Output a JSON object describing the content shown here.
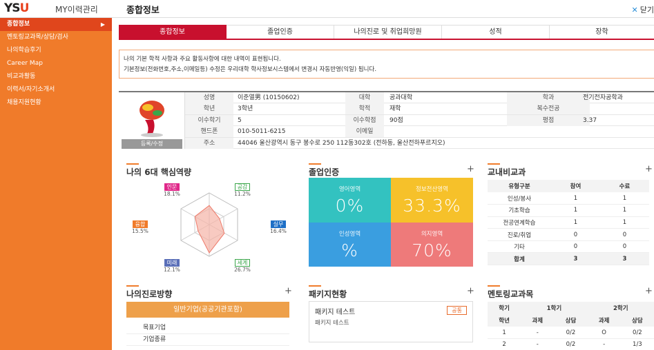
{
  "app": {
    "logo": "YSU",
    "name": "MY이력관리",
    "page_title": "종합정보",
    "close_label": "닫기"
  },
  "sidebar": {
    "items": [
      {
        "label": "종합정보",
        "active": true
      },
      {
        "label": "멘토링교과목/상담/검사"
      },
      {
        "label": "나의학습후기"
      },
      {
        "label": "Career Map"
      },
      {
        "label": "비교과활동"
      },
      {
        "label": "이력서/자기소개서"
      },
      {
        "label": "채용지원현황"
      }
    ]
  },
  "tabs": [
    "종합정보",
    "졸업인증",
    "나의진로 및 취업희망원",
    "성적",
    "장학"
  ],
  "notice": {
    "line1": "나의 기본 학적 사항과 주요 활동사항에 대한 내역이 표현됩니다.",
    "line2": "기본정보(전화번호,주소,이메일등) 수정은 우리대학 학사정보시스템에서 변경시 자동반영(익일) 됩니다."
  },
  "profile": {
    "edit_label": "등록/수정",
    "name_label": "성명",
    "name": "이준열男 (10150602)",
    "college_label": "대학",
    "college": "공과대학",
    "dept_label": "학과",
    "dept": "전기전자공학과",
    "year_label": "학년",
    "year": "3학년",
    "status_label": "학적",
    "status": "재학",
    "double_major_label": "복수전공",
    "double_major": "",
    "semester_label": "이수학기",
    "semester": "5",
    "credits_label": "이수학점",
    "credits": "90점",
    "gpa_label": "평점",
    "gpa": "3.37",
    "phone_label": "핸드폰",
    "phone": "010-5011-6215",
    "email_label": "이메일",
    "email": "",
    "address_label": "주소",
    "address": "44046 울산광역시 동구 봉수로 250 112동302호 (전하동, 울산전하푸르지오)"
  },
  "competency": {
    "title": "나의 6대 핵심역량",
    "items": [
      {
        "label": "인문",
        "value": "18.1%",
        "color": "#e0288a"
      },
      {
        "label": "공감",
        "value": "11.2%",
        "color": "#3aa64a"
      },
      {
        "label": "실무",
        "value": "16.4%",
        "color": "#1e6fc6"
      },
      {
        "label": "세계",
        "value": "26.7%",
        "color": "#3aa64a"
      },
      {
        "label": "미래",
        "value": "12.1%",
        "color": "#5a6fb8"
      },
      {
        "label": "융합",
        "value": "15.5%",
        "color": "#f07b2a"
      }
    ],
    "values": [
      18.1,
      11.2,
      16.4,
      26.7,
      12.1,
      15.5
    ]
  },
  "graduation": {
    "title": "졸업인증",
    "cells": [
      {
        "label": "영어영역",
        "value": "0%",
        "color": "#33c2c0"
      },
      {
        "label": "정보전산영역",
        "value": "33.3%",
        "color": "#f6c12a"
      },
      {
        "label": "인성영역",
        "value": "%",
        "color": "#3a9ee0"
      },
      {
        "label": "의지영역",
        "value": "70%",
        "color": "#ee7a7a"
      }
    ]
  },
  "extracurricular": {
    "title": "교내비교과",
    "headers": [
      "유형구분",
      "참여",
      "수료"
    ],
    "rows": [
      [
        "인성/봉사",
        "1",
        "1"
      ],
      [
        "기초학습",
        "1",
        "1"
      ],
      [
        "전공연계학습",
        "1",
        "1"
      ],
      [
        "진로/취업",
        "0",
        "0"
      ],
      [
        "기타",
        "0",
        "0"
      ]
    ],
    "total": [
      "합계",
      "3",
      "3"
    ]
  },
  "career": {
    "title": "나의진로방향",
    "button": "일반기업(공공기관포함)",
    "rows": [
      "목표기업",
      "기업종류"
    ]
  },
  "package": {
    "title": "패키지현황",
    "name": "패키지 테스트",
    "badge": "공통",
    "desc": "패키지 테스트"
  },
  "mentoring": {
    "title": "멘토링교과목",
    "semester_label": "학기",
    "sem1": "1학기",
    "sem2": "2학기",
    "headers": [
      "학년",
      "과제",
      "상담",
      "과제",
      "상담"
    ],
    "rows": [
      [
        "1",
        "-",
        "0/2",
        "O",
        "0/2"
      ],
      [
        "2",
        "-",
        "0/2",
        "-",
        "1/3"
      ]
    ]
  }
}
